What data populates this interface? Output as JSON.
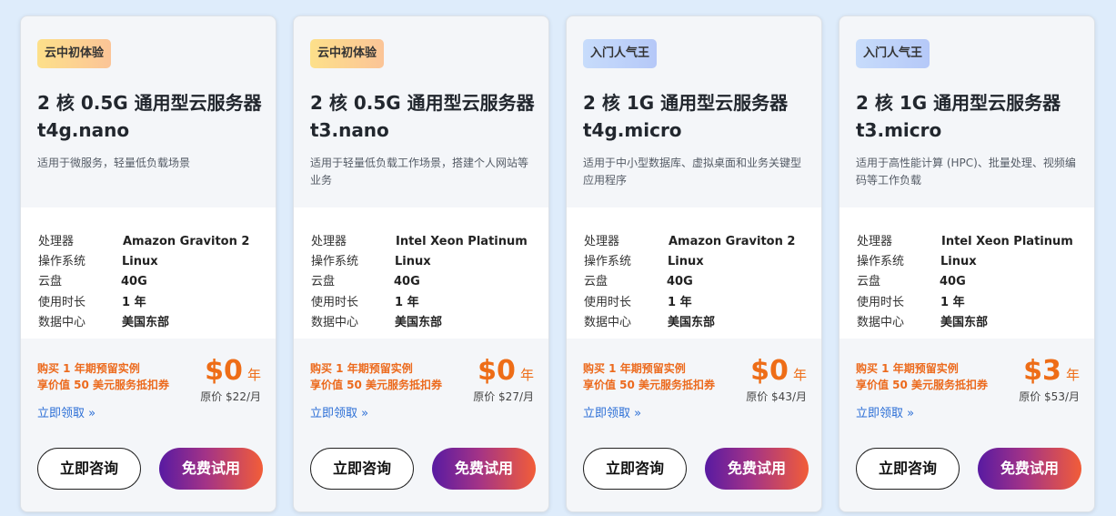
{
  "cards": [
    {
      "badge": "云中初体验",
      "badge_color": "#fde08a",
      "title_line1": "2 核 0.5G 通用型云服务器",
      "title_line2": "t4g.nano",
      "description": "适用于微服务，轻量低负载场景",
      "specs": [
        {
          "label": "处理器",
          "value": "Amazon Graviton 2"
        },
        {
          "label": "操作系统",
          "value": "Linux"
        },
        {
          "label": "云盘",
          "value": "40G"
        },
        {
          "label": "使用时长",
          "value": "1 年"
        },
        {
          "label": "数据中心",
          "value": "美国东部"
        }
      ],
      "promo_line1": "购买 1 年期预留实例",
      "promo_line2": "享价值 50 美元服务抵扣券",
      "price": "$0",
      "price_unit": "年",
      "original_price": "原价 $22/月",
      "claim_link": "立即领取 »",
      "consult_button": "立即咨询",
      "trial_button": "免费试用"
    },
    {
      "badge": "云中初体验",
      "badge_color": "#fde08a",
      "title_line1": "2 核 0.5G 通用型云服务器",
      "title_line2": "t3.nano",
      "description": "适用于轻量低负载工作场景，搭建个人网站等业务",
      "specs": [
        {
          "label": "处理器",
          "value": "Intel Xeon Platinum"
        },
        {
          "label": "操作系统",
          "value": "Linux"
        },
        {
          "label": "云盘",
          "value": "40G"
        },
        {
          "label": "使用时长",
          "value": "1 年"
        },
        {
          "label": "数据中心",
          "value": "美国东部"
        }
      ],
      "promo_line1": "购买 1 年期预留实例",
      "promo_line2": "享价值 50 美元服务抵扣券",
      "price": "$0",
      "price_unit": "年",
      "original_price": "原价 $27/月",
      "claim_link": "立即领取 »",
      "consult_button": "立即咨询",
      "trial_button": "免费试用"
    },
    {
      "badge": "入门人气王",
      "badge_color": "#c7dcfb",
      "title_line1": "2 核 1G 通用型云服务器",
      "title_line2": "t4g.micro",
      "description": "适用于中小型数据库、虚拟桌面和业务关键型应用程序",
      "specs": [
        {
          "label": "处理器",
          "value": "Amazon Graviton 2"
        },
        {
          "label": "操作系统",
          "value": "Linux"
        },
        {
          "label": "云盘",
          "value": "40G"
        },
        {
          "label": "使用时长",
          "value": "1 年"
        },
        {
          "label": "数据中心",
          "value": "美国东部"
        }
      ],
      "promo_line1": "购买 1 年期预留实例",
      "promo_line2": "享价值 50 美元服务抵扣券",
      "price": "$0",
      "price_unit": "年",
      "original_price": "原价 $43/月",
      "claim_link": "立即领取 »",
      "consult_button": "立即咨询",
      "trial_button": "免费试用"
    },
    {
      "badge": "入门人气王",
      "badge_color": "#c7dcfb",
      "title_line1": "2 核 1G 通用型云服务器",
      "title_line2": "t3.micro",
      "description": "适用于高性能计算 (HPC)、批量处理、视频编码等工作负载",
      "specs": [
        {
          "label": "处理器",
          "value": "Intel Xeon Platinum"
        },
        {
          "label": "操作系统",
          "value": "Linux"
        },
        {
          "label": "云盘",
          "value": "40G"
        },
        {
          "label": "使用时长",
          "value": "1 年"
        },
        {
          "label": "数据中心",
          "value": "美国东部"
        }
      ],
      "promo_line1": "购买 1 年期预留实例",
      "promo_line2": "享价值 50 美元服务抵扣券",
      "price": "$3",
      "price_unit": "年",
      "original_price": "原价 $53/月",
      "claim_link": "立即领取 »",
      "consult_button": "立即咨询",
      "trial_button": "免费试用"
    }
  ]
}
